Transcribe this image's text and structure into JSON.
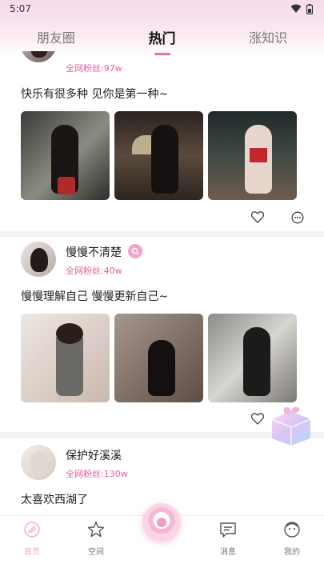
{
  "status_bar": {
    "time": "5:07"
  },
  "tabs": [
    {
      "label": "朋友圈"
    },
    {
      "label": "热门"
    },
    {
      "label": "涨知识"
    }
  ],
  "posts": [
    {
      "fans": "全网粉丝:97w",
      "text": "快乐有很多种 见你是第一种~"
    },
    {
      "nickname": "慢慢不清楚",
      "fans": "全网粉丝:40w",
      "text": "慢慢理解自己 慢慢更新自己~"
    },
    {
      "nickname": "保护好溪溪",
      "fans": "全网粉丝:130w",
      "text": "太喜欢西湖了"
    }
  ],
  "bottom_nav": [
    {
      "label": "首页",
      "icon": "home-icon"
    },
    {
      "label": "空间",
      "icon": "star-icon"
    },
    {
      "label": "",
      "icon": "center-action-icon"
    },
    {
      "label": "消息",
      "icon": "message-icon"
    },
    {
      "label": "我的",
      "icon": "profile-icon"
    }
  ],
  "colors": {
    "accent": "#f16aa7",
    "fans": "#ef5c9e",
    "nav_active": "#f0a8c8"
  }
}
